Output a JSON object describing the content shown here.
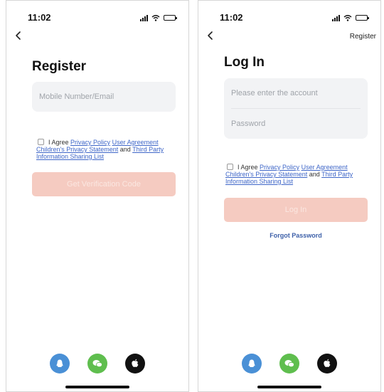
{
  "status": {
    "time": "11:02"
  },
  "register": {
    "title": "Register",
    "input_placeholder": "Mobile Number/Email",
    "agree_text": "I Agree",
    "privacy_policy": "Privacy Policy",
    "user_agreement": "User Agreement",
    "childrens_statement": "Children's Privacy Statement",
    "and_text": "and",
    "third_party": "Third Party Information Sharing List",
    "button_label": "Get Verification Code"
  },
  "login": {
    "top_link": "Register",
    "title": "Log In",
    "account_placeholder": "Please enter the account",
    "password_placeholder": "Password",
    "agree_text": "I Agree",
    "privacy_policy": "Privacy Policy",
    "user_agreement": "User Agreement",
    "childrens_statement": "Children's Privacy Statement",
    "and_text": "and",
    "third_party": "Third Party Information Sharing List",
    "button_label": "Log In",
    "forgot_password": "Forgot Password"
  },
  "social_icons": [
    "qq-icon",
    "wechat-icon",
    "apple-icon"
  ],
  "colors": {
    "button_disabled": "#f5cbc1",
    "link": "#3e66c8",
    "qq": "#4a90d6",
    "wechat": "#5fbe4e",
    "apple": "#111111"
  }
}
